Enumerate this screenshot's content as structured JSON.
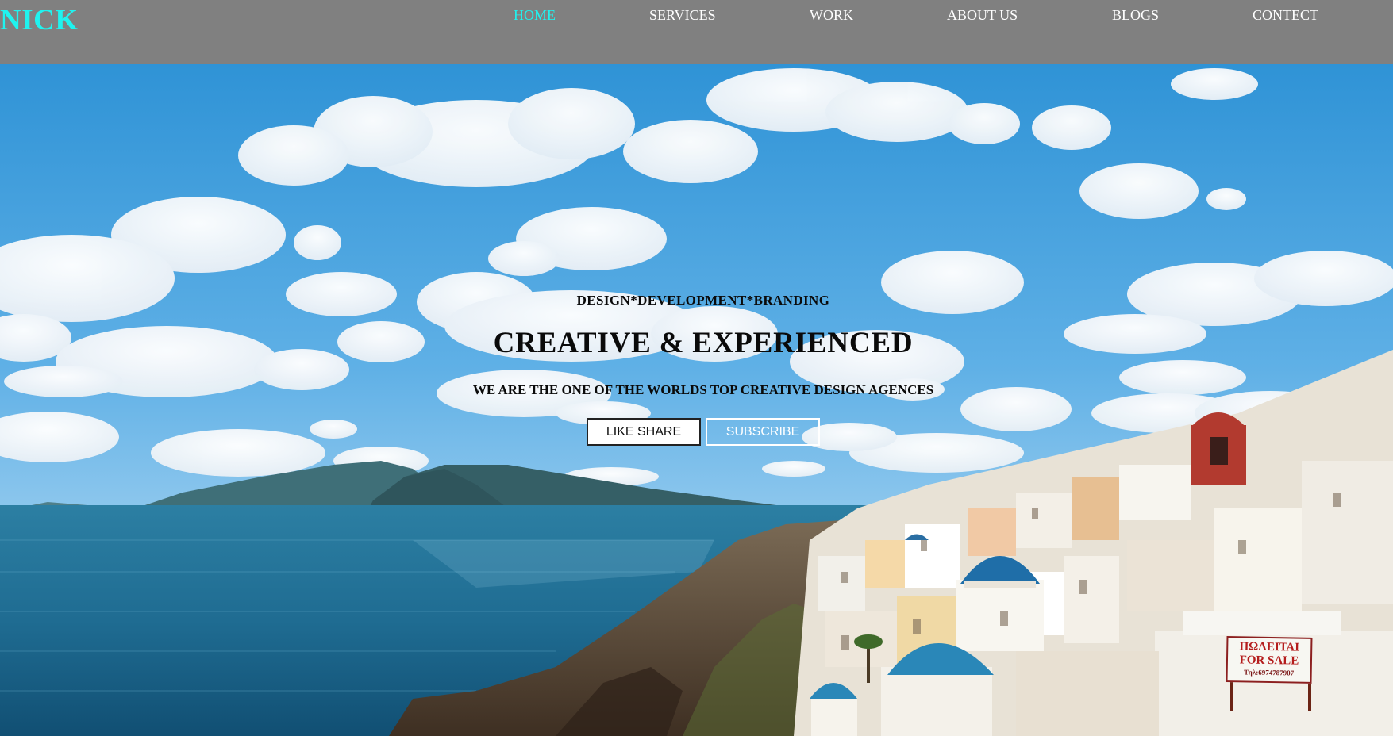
{
  "header": {
    "logo": "NICK",
    "nav": [
      {
        "label": "HOME",
        "active": true
      },
      {
        "label": "SERVICES",
        "active": false
      },
      {
        "label": "WORK",
        "active": false
      },
      {
        "label": "ABOUT US",
        "active": false
      },
      {
        "label": "BLOGS",
        "active": false
      },
      {
        "label": "CONTECT",
        "active": false
      }
    ]
  },
  "hero": {
    "tagline": "DESIGN*DEVELOPMENT*BRANDING",
    "headline": "CREATIVE & EXPERIENCED",
    "subline": "WE ARE THE ONE OF THE WORLDS TOP CREATIVE DESIGN AGENCES",
    "buttons": {
      "like_share": "LIKE SHARE",
      "subscribe": "SUBSCRIBE"
    },
    "sign": {
      "line1": "ΠΩΛΕΙΤΑΙ",
      "line2": "FOR SALE",
      "line3": "Τηλ:6974787907"
    }
  },
  "colors": {
    "header_bg": "#808080",
    "accent": "#1ff3ef",
    "nav_text": "#ffffff"
  }
}
